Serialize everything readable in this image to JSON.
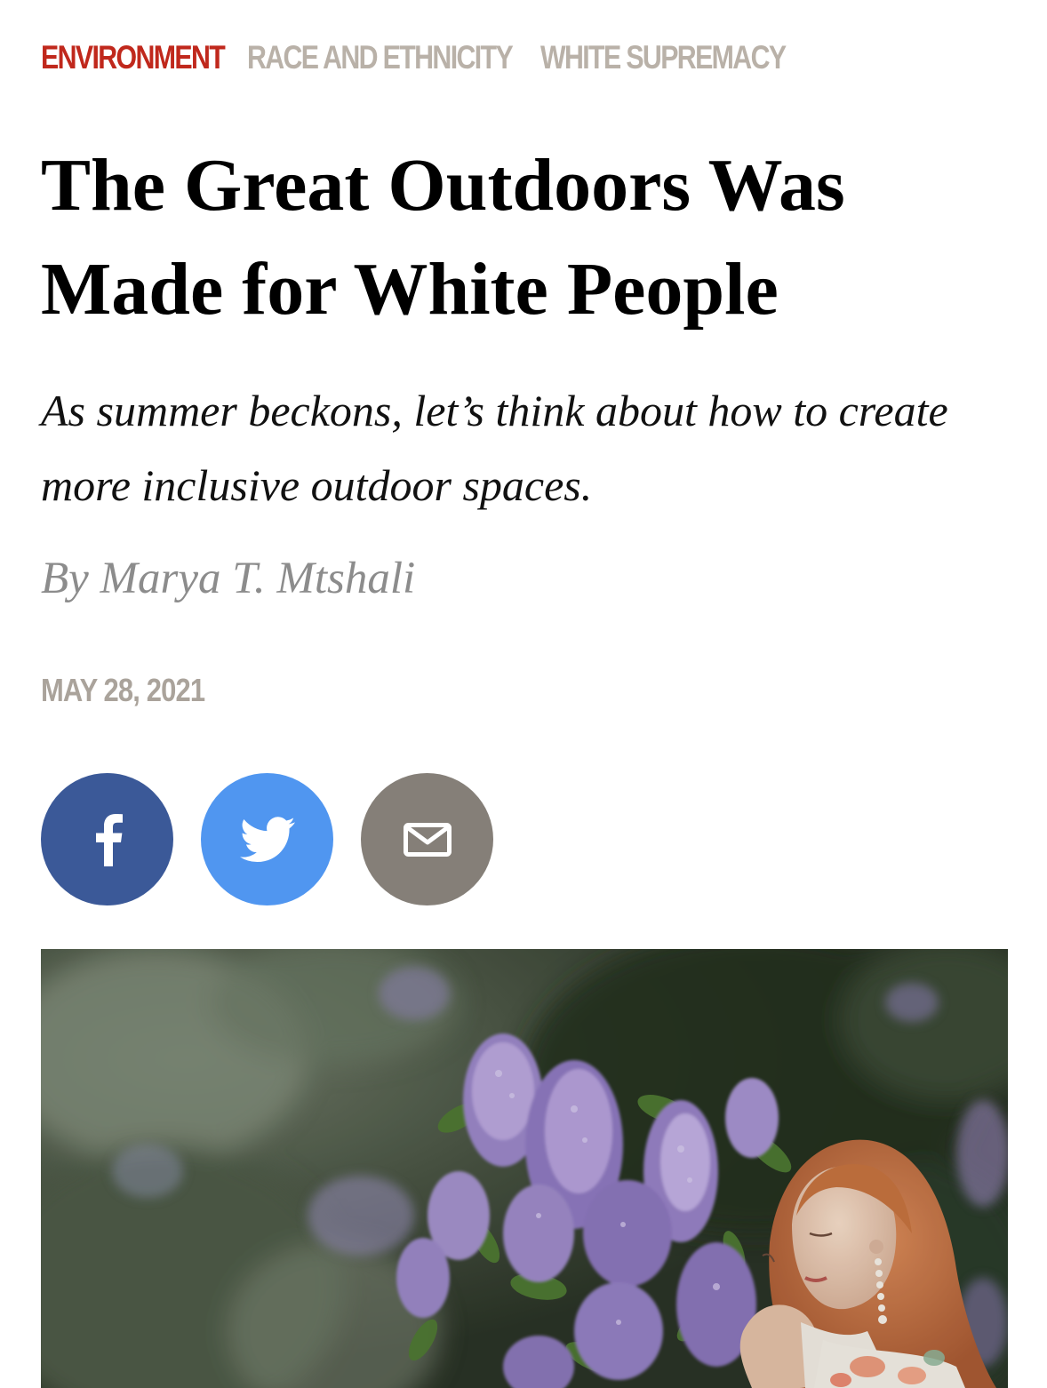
{
  "tags": [
    {
      "label": "ENVIRONMENT",
      "color": "#c0281c"
    },
    {
      "label": "RACE AND ETHNICITY",
      "color": "#b9b1a8"
    },
    {
      "label": "WHITE SUPREMACY",
      "color": "#b9b1a8"
    }
  ],
  "article": {
    "title": "The Great Outdoors Was Made for White People",
    "dek": "As summer beckons, let’s think about how to create more inclusive outdoor spaces.",
    "byline": "By Marya T. Mtshali",
    "date": "MAY 28, 2021"
  },
  "share": {
    "facebook": {
      "icon": "facebook-icon",
      "color": "#3b5998"
    },
    "twitter": {
      "icon": "twitter-icon",
      "color": "#5096f0"
    },
    "email": {
      "icon": "email-icon",
      "color": "#857f78"
    }
  },
  "hero_image": {
    "subject": "woman with red hair smelling purple lilac blossoms"
  }
}
